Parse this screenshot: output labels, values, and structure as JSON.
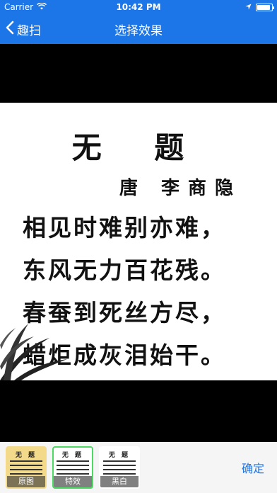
{
  "status_bar": {
    "carrier": "Carrier",
    "time": "10:42 PM"
  },
  "nav": {
    "back_label": "趣扫",
    "title": "选择效果"
  },
  "poem": {
    "title": "无 题",
    "author": "唐 李商隐",
    "lines": [
      "相见时难别亦难，",
      "东风无力百花残。",
      "春蚕到死丝方尽，",
      "蜡炬成灰泪始干。"
    ]
  },
  "effects": [
    {
      "label": "原图",
      "selected": false
    },
    {
      "label": "特效",
      "selected": true
    },
    {
      "label": "黑白",
      "selected": false
    }
  ],
  "confirm_label": "确定",
  "colors": {
    "accent": "#1d76e8",
    "selected_border": "#4cd964"
  }
}
